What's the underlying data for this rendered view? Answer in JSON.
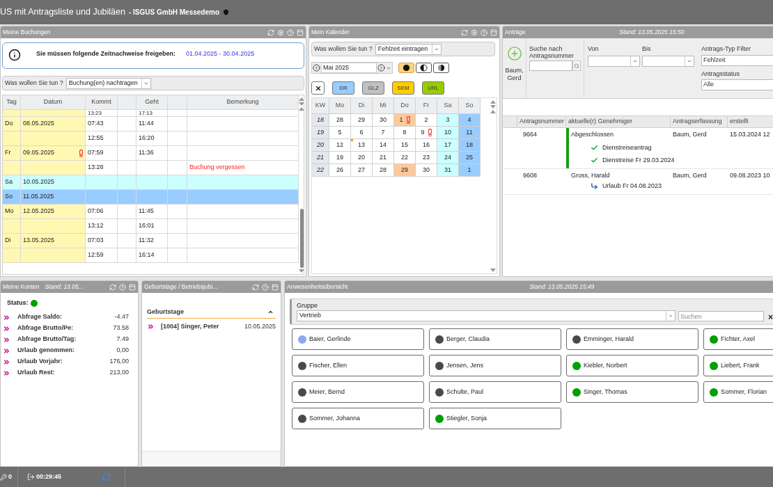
{
  "window": {
    "title": "US mit Antragsliste und Jubiläen",
    "subtitle": "- ISGUS GmbH Messedemo"
  },
  "bookings": {
    "title": "Meine Buchungen",
    "notice": {
      "text": "Sie müssen folgende Zeitnachweise freigeben:",
      "period": "01.04.2025 - 30.04.2025"
    },
    "action": {
      "label": "Was wollen Sie tun ?",
      "value": "Buchung(en) nachtragen"
    },
    "columns": [
      "Tag",
      "Datum",
      "Kommt",
      "Geht",
      "Bemerkung"
    ],
    "cut_row": {
      "in": "13:23",
      "out": "17:13"
    },
    "rows": [
      {
        "kind": "weekday",
        "day": "Do",
        "date": "08.05.2025",
        "in": "07:43",
        "out": "11:44",
        "warning": false
      },
      {
        "kind": "weekday",
        "in": "12:55",
        "out": "16:20",
        "warning": false
      },
      {
        "kind": "weekday",
        "day": "Fr",
        "date": "09.05.2025",
        "in": "07:59",
        "out": "11:36",
        "warning": true
      },
      {
        "kind": "weekday",
        "in": "13:28",
        "remark": "Buchung vergessen",
        "warning": false
      },
      {
        "kind": "saturday",
        "day": "Sa",
        "date": "10.05.2025",
        "warning": false
      },
      {
        "kind": "sunday",
        "day": "So",
        "date": "11.05.2025",
        "warning": false
      },
      {
        "kind": "weekday",
        "day": "Mo",
        "date": "12.05.2025",
        "in": "07:06",
        "out": "11:45",
        "warning": false
      },
      {
        "kind": "weekday",
        "in": "13:12",
        "out": "16:01",
        "warning": false
      },
      {
        "kind": "weekday",
        "day": "Di",
        "date": "13.05.2025",
        "in": "07:03",
        "out": "11:32",
        "warning": false
      },
      {
        "kind": "weekday",
        "in": "12:59",
        "out": "16:14",
        "warning": false
      }
    ]
  },
  "calendar": {
    "title": "Mein Kalender",
    "action": {
      "label": "Was wollen Sie tun ?",
      "value": "Fehlzeit eintragen"
    },
    "month": "Mai 2025",
    "view_modes": [
      {
        "kind": "full",
        "selected": true
      },
      {
        "kind": "half",
        "selected": false
      },
      {
        "kind": "partial",
        "selected": false
      }
    ],
    "types": [
      {
        "label": "DR",
        "color": "#99ccff"
      },
      {
        "label": "GLZ",
        "color": "#c0c0c0"
      },
      {
        "label": "SEM",
        "color": "#ffcc00"
      },
      {
        "label": "URL",
        "color": "#99cc00"
      }
    ],
    "columns": [
      "KW",
      "Mo",
      "Di",
      "Mi",
      "Do",
      "Fr",
      "Sa",
      "So"
    ],
    "weeks": [
      {
        "kw": "18",
        "days": [
          {
            "day": "28",
            "kind": "workday",
            "warning": false,
            "marker": false
          },
          {
            "day": "29",
            "kind": "workday",
            "warning": false,
            "marker": false
          },
          {
            "day": "30",
            "kind": "workday",
            "warning": false,
            "marker": false
          },
          {
            "day": "1",
            "kind": "holiday",
            "warning": true,
            "marker": false
          },
          {
            "day": "2",
            "kind": "workday",
            "warning": false,
            "marker": false
          },
          {
            "day": "3",
            "kind": "saturday",
            "warning": false,
            "marker": false
          },
          {
            "day": "4",
            "kind": "sunday",
            "warning": false,
            "marker": false
          }
        ]
      },
      {
        "kw": "19",
        "days": [
          {
            "day": "5",
            "kind": "workday",
            "warning": false,
            "marker": false
          },
          {
            "day": "6",
            "kind": "workday",
            "warning": false,
            "marker": false
          },
          {
            "day": "7",
            "kind": "workday",
            "warning": false,
            "marker": false
          },
          {
            "day": "8",
            "kind": "workday",
            "warning": false,
            "marker": false
          },
          {
            "day": "9",
            "kind": "workday",
            "warning": true,
            "marker": false
          },
          {
            "day": "10",
            "kind": "saturday",
            "warning": false,
            "marker": false
          },
          {
            "day": "11",
            "kind": "sunday",
            "warning": false,
            "marker": false
          }
        ]
      },
      {
        "kw": "20",
        "days": [
          {
            "day": "12",
            "kind": "workday",
            "warning": false,
            "marker": false
          },
          {
            "day": "13",
            "kind": "workday",
            "warning": false,
            "marker": true
          },
          {
            "day": "14",
            "kind": "workday",
            "warning": false,
            "marker": false
          },
          {
            "day": "15",
            "kind": "workday",
            "warning": false,
            "marker": false
          },
          {
            "day": "16",
            "kind": "workday",
            "warning": false,
            "marker": false
          },
          {
            "day": "17",
            "kind": "saturday",
            "warning": false,
            "marker": false
          },
          {
            "day": "18",
            "kind": "sunday",
            "warning": false,
            "marker": false
          }
        ]
      },
      {
        "kw": "21",
        "days": [
          {
            "day": "19",
            "kind": "workday",
            "warning": false,
            "marker": false
          },
          {
            "day": "20",
            "kind": "workday",
            "warning": false,
            "marker": false
          },
          {
            "day": "21",
            "kind": "workday",
            "warning": false,
            "marker": false
          },
          {
            "day": "22",
            "kind": "workday",
            "warning": false,
            "marker": false
          },
          {
            "day": "23",
            "kind": "workday",
            "warning": false,
            "marker": false
          },
          {
            "day": "24",
            "kind": "saturday",
            "warning": false,
            "marker": false
          },
          {
            "day": "25",
            "kind": "sunday",
            "warning": false,
            "marker": false
          }
        ]
      },
      {
        "kw": "22",
        "days": [
          {
            "day": "26",
            "kind": "workday",
            "warning": false,
            "marker": false
          },
          {
            "day": "27",
            "kind": "workday",
            "warning": false,
            "marker": false
          },
          {
            "day": "28",
            "kind": "workday",
            "warning": false,
            "marker": false
          },
          {
            "day": "29",
            "kind": "holiday",
            "warning": false,
            "marker": false
          },
          {
            "day": "30",
            "kind": "workday",
            "warning": false,
            "marker": false
          },
          {
            "day": "31",
            "kind": "saturday",
            "warning": false,
            "marker": false
          },
          {
            "day": "1",
            "kind": "sunday",
            "warning": false,
            "marker": false
          }
        ]
      }
    ]
  },
  "requests": {
    "title": "Anträge",
    "stand": "Stand: 13.05.2025 15:50",
    "new_label": "Baum, Gerd",
    "search_label": "Suche nach Antragsnummer",
    "from_label": "Von",
    "to_label": "Bis",
    "type_filter": {
      "label": "Antrags-Typ Filter",
      "value": "Fehlzeit"
    },
    "status_filter": {
      "label": "Antragsstatus",
      "value": "Alle"
    },
    "columns": [
      "Antragsnummer",
      "aktuelle(r) Genehmiger",
      "Antragserfassung",
      "erstellt"
    ],
    "rows": [
      {
        "number": "9664",
        "approver": "Abgeschlossen",
        "closed": true,
        "creator": "Baum, Gerd",
        "created": "15.03.2024 12",
        "steps": [
          {
            "kind": "approved",
            "text": "Dienstreiseantrag"
          },
          {
            "kind": "approved",
            "text": "Dienstreise Fr 29.03.2024"
          }
        ]
      },
      {
        "number": "9608",
        "approver": "Gross, Harald",
        "closed": false,
        "creator": "Baum, Gerd",
        "created": "09.08.2023 10",
        "steps": [
          {
            "kind": "forwarded",
            "text": "Urlaub Fr 04.08.2023"
          }
        ]
      }
    ]
  },
  "accounts": {
    "title": "Meine Konten",
    "stand": "Stand: 13.05...",
    "status": {
      "label": "Status:",
      "color": "#00a000"
    },
    "rows": [
      {
        "label": "Abfrage Saldo:",
        "value": "-4.47"
      },
      {
        "label": "Abfrage Brutto/Pe:",
        "value": "73.58"
      },
      {
        "label": "Abfrage Brutto/Tag:",
        "value": "7.49"
      },
      {
        "label": "Urlaub genommen:",
        "value": "0,00"
      },
      {
        "label": "Urlaub Vorjahr:",
        "value": "176,00"
      },
      {
        "label": "Urlaub Rest:",
        "value": "213,00"
      }
    ]
  },
  "birthdays": {
    "title": "Geburtstage / Betriebsjubi...",
    "section": {
      "title": "Geburtstage",
      "expanded": true
    },
    "rows": [
      {
        "name": "[1004] Singer, Peter",
        "date": "10.05.2025"
      }
    ]
  },
  "presence": {
    "title": "Anwesenheitsübersicht",
    "stand": "Stand: 13.05.2025 15:49",
    "group": {
      "label": "Gruppe",
      "value": "Vertrieb"
    },
    "search": {
      "placeholder": "Suchen"
    },
    "clear": "×",
    "people": [
      {
        "name": "Baier, Gerlinde",
        "color": "#8fa6f0"
      },
      {
        "name": "Berger, Claudia",
        "color": "#4a4a4a"
      },
      {
        "name": "Emminger, Harald",
        "color": "#4a4a4a"
      },
      {
        "name": "Fichter, Axel",
        "color": "#00a000"
      },
      {
        "name": "Fischer, Ellen",
        "color": "#4a4a4a"
      },
      {
        "name": "Jensen, Jens",
        "color": "#4a4a4a"
      },
      {
        "name": "Kiebler, Norbert",
        "color": "#00a000"
      },
      {
        "name": "Liebert, Frank",
        "color": "#00a000"
      },
      {
        "name": "Meier, Bernd",
        "color": "#4a4a4a"
      },
      {
        "name": "Schulte, Paul",
        "color": "#4a4a4a"
      },
      {
        "name": "Singer, Thomas",
        "color": "#00a000"
      },
      {
        "name": "Sommer, Florian",
        "color": "#00a000"
      },
      {
        "name": "Sommer, Johanna",
        "color": "#4a4a4a"
      },
      {
        "name": "Stiegler, Sonja",
        "color": "#00a000"
      }
    ]
  },
  "status_bar": {
    "count": "0",
    "session": "00:29:45"
  }
}
